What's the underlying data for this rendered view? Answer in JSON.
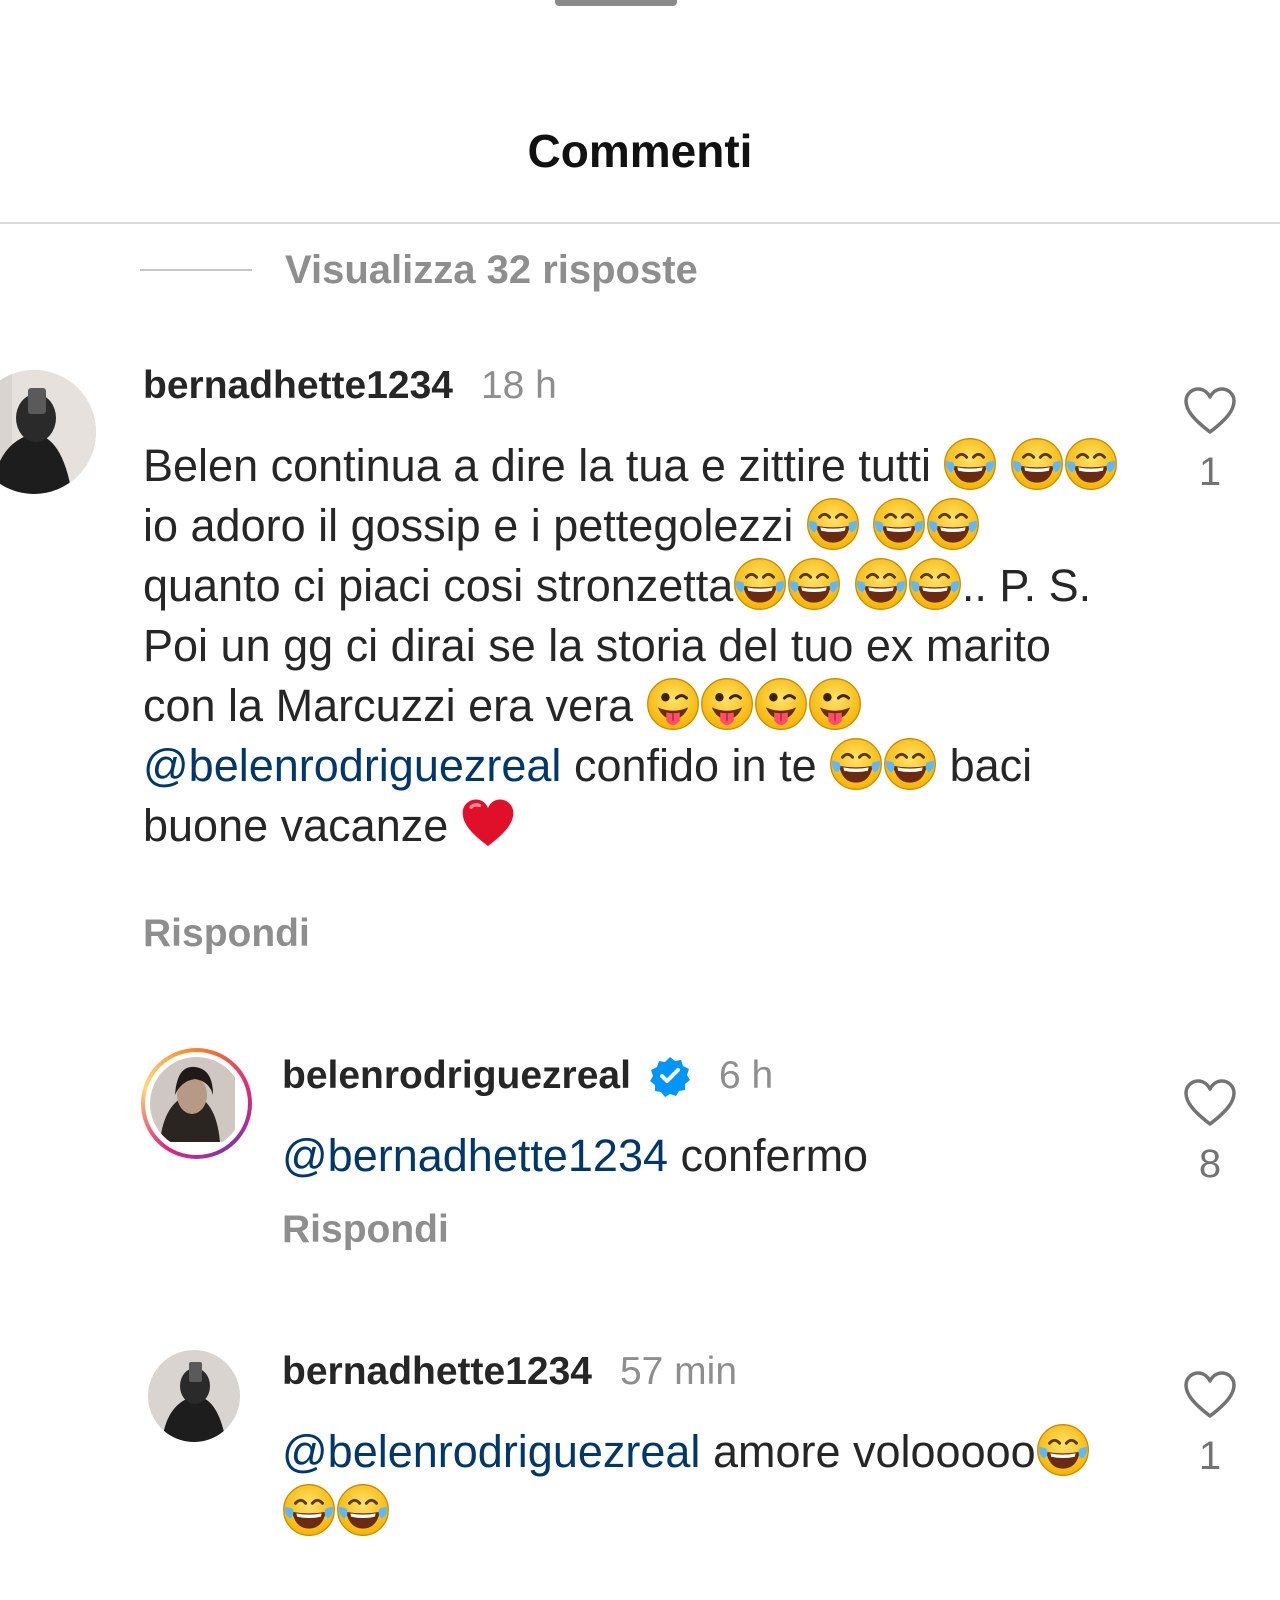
{
  "header": {
    "title": "Commenti"
  },
  "view_replies": {
    "label": "Visualizza 32 risposte"
  },
  "icons": {
    "like": "heart-outline-icon",
    "laugh": "face-with-tears-of-joy-emoji",
    "tongue": "winking-face-with-tongue-emoji",
    "heart": "red-heart-emoji",
    "verified": "verified-badge-icon"
  },
  "colors": {
    "mention": "#00376b",
    "verified": "#0095f6",
    "muted": "#8e8e8e"
  },
  "comments": [
    {
      "username": "bernadhette1234",
      "time": "18 h",
      "text": {
        "p1": "Belen continua a dire la tua e zittire tutti ",
        "p2": "io adoro il gossip e i pettegolezzi ",
        "p3": " quanto ci piaci cosi stronzetta",
        "p4": ".. P. S. Poi un gg ci dirai se la storia del tuo ex marito con la Marcuzzi era vera ",
        "mention": "@belenrodriguezreal",
        "p5": "  confido in te ",
        "p6": " baci buone vacanze "
      },
      "reply_label": "Rispondi",
      "likes": "1"
    },
    {
      "username": "belenrodriguezreal",
      "time": "6 h",
      "verified": true,
      "mention": "@bernadhette1234",
      "text": " confermo",
      "reply_label": "Rispondi",
      "likes": "8"
    },
    {
      "username": "bernadhette1234",
      "time": "57 min",
      "mention": "@belenrodriguezreal",
      "text": " amore volooooo",
      "likes": "1"
    }
  ]
}
